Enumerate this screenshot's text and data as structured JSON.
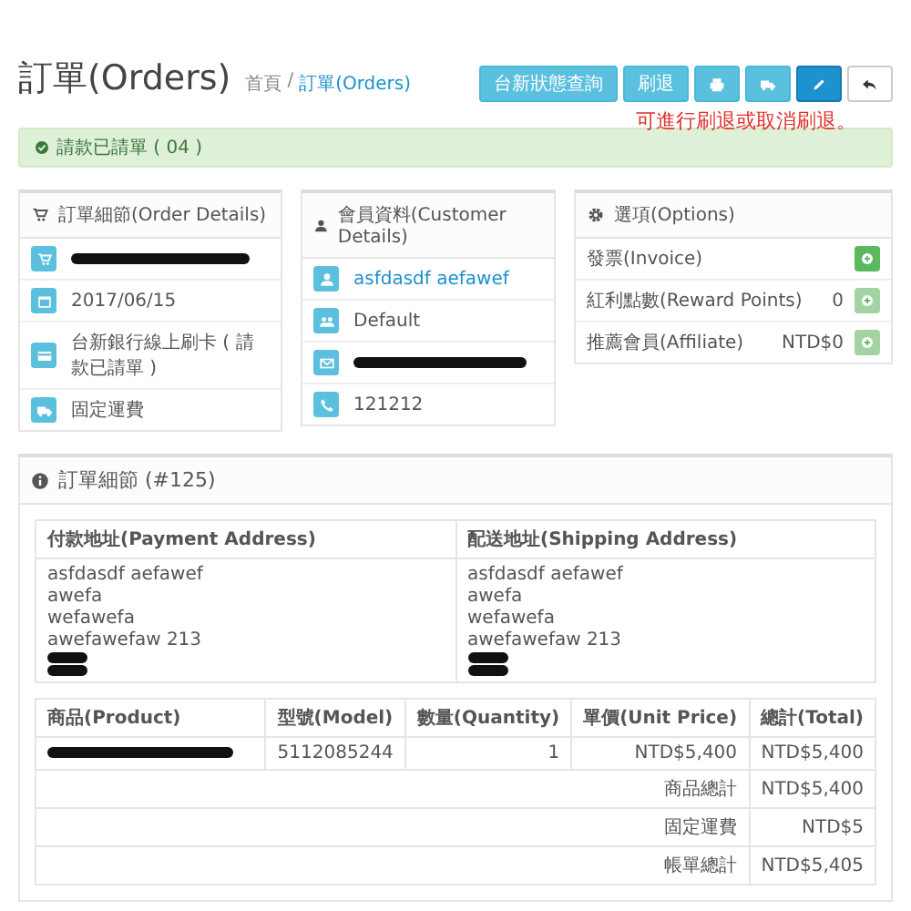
{
  "header": {
    "title": "訂單(Orders)",
    "breadcrumb_separator": "/",
    "breadcrumb": [
      {
        "label": "首頁",
        "selected": false
      },
      {
        "label": "訂單(Orders)",
        "selected": true
      }
    ],
    "buttons": [
      {
        "kind": "text",
        "label": "台新狀態查詢"
      },
      {
        "kind": "text",
        "label": "刷退"
      },
      {
        "kind": "print"
      },
      {
        "kind": "ship"
      },
      {
        "kind": "edit"
      },
      {
        "kind": "back"
      }
    ],
    "note": "可進行刷退或取消刷退。"
  },
  "alert": "請款已請單 ( 04 )",
  "panels": [
    {
      "title": "訂單細節(Order Details)",
      "rows": [
        {
          "kind": "redacted"
        },
        {
          "kind": "text",
          "text": "2017/06/15"
        },
        {
          "kind": "text",
          "text": "台新銀行線上刷卡 ( 請款已請單 )"
        },
        {
          "kind": "text",
          "text": "固定運費"
        }
      ]
    },
    {
      "title": "會員資料(Customer Details)",
      "rows": [
        {
          "kind": "link",
          "text": "asfdasdf aefawef"
        },
        {
          "kind": "text",
          "text": "Default"
        },
        {
          "kind": "redacted"
        },
        {
          "kind": "text",
          "text": "121212"
        }
      ]
    }
  ],
  "options": {
    "title": "選項(Options)",
    "rows": [
      {
        "label": "發票(Invoice)",
        "disabled": false
      },
      {
        "label": "紅利點數(Reward Points)",
        "value": "0",
        "disabled": true
      },
      {
        "label": "推薦會員(Affiliate)",
        "value": "NTD$0",
        "disabled": true
      }
    ]
  },
  "order": {
    "title": "訂單細節 (#125)",
    "addresses": [
      {
        "heading": "付款地址(Payment Address)",
        "lines": [
          {
            "kind": "text",
            "text": "asfdasdf aefawef"
          },
          {
            "kind": "text",
            "text": "awefa"
          },
          {
            "kind": "text",
            "text": "wefawefa"
          },
          {
            "kind": "text",
            "text": "awefawefaw 213"
          },
          {
            "kind": "redacted"
          },
          {
            "kind": "redacted"
          }
        ]
      },
      {
        "heading": "配送地址(Shipping Address)",
        "lines": [
          {
            "kind": "text",
            "text": "asfdasdf aefawef"
          },
          {
            "kind": "text",
            "text": "awefa"
          },
          {
            "kind": "text",
            "text": "wefawefa"
          },
          {
            "kind": "text",
            "text": "awefawefaw 213"
          },
          {
            "kind": "redacted"
          },
          {
            "kind": "redacted"
          }
        ]
      }
    ],
    "columns": [
      "商品(Product)",
      "型號(Model)",
      "數量(Quantity)",
      "單價(Unit Price)",
      "總計(Total)"
    ],
    "items": [
      {
        "model": "5112085244",
        "quantity": "1",
        "price": "NTD$5,400",
        "total": "NTD$5,400"
      }
    ],
    "totals": [
      {
        "label": "商品總計",
        "value": "NTD$5,400"
      },
      {
        "label": "固定運費",
        "value": "NTD$5"
      },
      {
        "label": "帳單總計",
        "value": "NTD$5,405"
      }
    ]
  }
}
